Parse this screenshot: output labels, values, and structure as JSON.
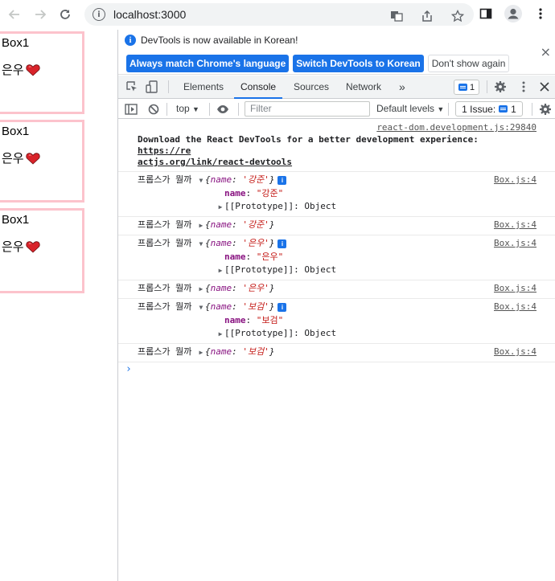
{
  "browser": {
    "url": "localhost:3000"
  },
  "boxes": [
    {
      "title": "Box1",
      "name": "은우"
    },
    {
      "title": "Box1",
      "name": "은우"
    },
    {
      "title": "Box1",
      "name": "은우"
    }
  ],
  "devtools": {
    "infobar": {
      "message": "DevTools is now available in Korean!",
      "btn_match": "Always match Chrome's language",
      "btn_switch": "Switch DevTools to Korean",
      "btn_dismiss": "Don't show again"
    },
    "tabs": {
      "elements": "Elements",
      "console": "Console",
      "sources": "Sources",
      "network": "Network",
      "more": "»"
    },
    "message_count": "1",
    "toolbar": {
      "context": "top",
      "filter_placeholder": "Filter",
      "levels": "Default levels",
      "issues": "1 Issue:",
      "issue_count": "1"
    },
    "console": {
      "first_source": "react-dom.development.js:29840",
      "first_msg": "Download the React DevTools for a better development experience: ",
      "first_link_a": "https://re",
      "first_link_b": "actjs.org/link/react-devtools",
      "label": "프롭스가 뭘까",
      "source": "Box.js:4",
      "prototype": "[[Prototype]]: Object",
      "logs": [
        {
          "value": "강준",
          "expanded": true
        },
        {
          "value": "강준",
          "expanded": false
        },
        {
          "value": "은우",
          "expanded": true
        },
        {
          "value": "은우",
          "expanded": false
        },
        {
          "value": "보검",
          "expanded": true
        },
        {
          "value": "보검",
          "expanded": false
        }
      ]
    }
  }
}
